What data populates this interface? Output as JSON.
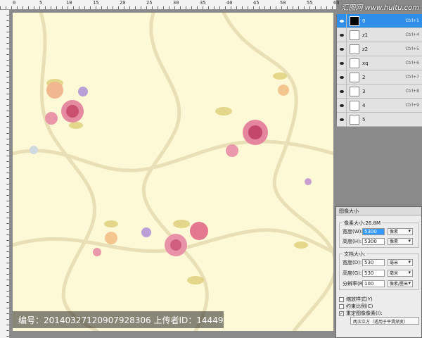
{
  "watermark": "汇图网 www.huitu.com",
  "ruler_numbers": [
    "0",
    "5",
    "10",
    "15",
    "20",
    "25",
    "30",
    "35",
    "40",
    "45",
    "50",
    "55",
    "60"
  ],
  "overlay": {
    "text": "编号：20140327120907928306 上传者ID：14449"
  },
  "layers": [
    {
      "name": "0",
      "shortcut": "Ctrl+1",
      "active": true,
      "thumb": "black"
    },
    {
      "name": "z1",
      "shortcut": "Ctrl+4",
      "active": false,
      "thumb": "white"
    },
    {
      "name": "z2",
      "shortcut": "Ctrl+5",
      "active": false,
      "thumb": "white"
    },
    {
      "name": "xq",
      "shortcut": "Ctrl+6",
      "active": false,
      "thumb": "white"
    },
    {
      "name": "2",
      "shortcut": "Ctrl+7",
      "active": false,
      "thumb": "white"
    },
    {
      "name": "3",
      "shortcut": "Ctrl+8",
      "active": false,
      "thumb": "white"
    },
    {
      "name": "4",
      "shortcut": "Ctrl+9",
      "active": false,
      "thumb": "white"
    },
    {
      "name": "5",
      "shortcut": "",
      "active": false,
      "thumb": "white"
    }
  ],
  "dialog": {
    "title": "图像大小",
    "pixel_legend": "像素大小:26.8M",
    "width_label": "宽度(W):",
    "width_value": "5300",
    "width_unit": "像素",
    "height_label": "高度(H):",
    "height_value": "5300",
    "height_unit": "像素",
    "doc_legend": "文档大小:",
    "doc_width_label": "宽度(D):",
    "doc_width_value": "530",
    "doc_width_unit": "毫米",
    "doc_height_label": "高度(G):",
    "doc_height_value": "530",
    "doc_height_unit": "毫米",
    "resolution_label": "分辨率(R):",
    "resolution_value": "100",
    "resolution_unit": "像素/厘米",
    "scale_styles": "缩放样式(Y)",
    "scale_styles_checked": false,
    "constrain": "约束比例(C)",
    "constrain_checked": false,
    "resample": "重定图像像素(I):",
    "resample_checked": true,
    "resample_method": "两次立方（适用于平滑渐变）"
  }
}
